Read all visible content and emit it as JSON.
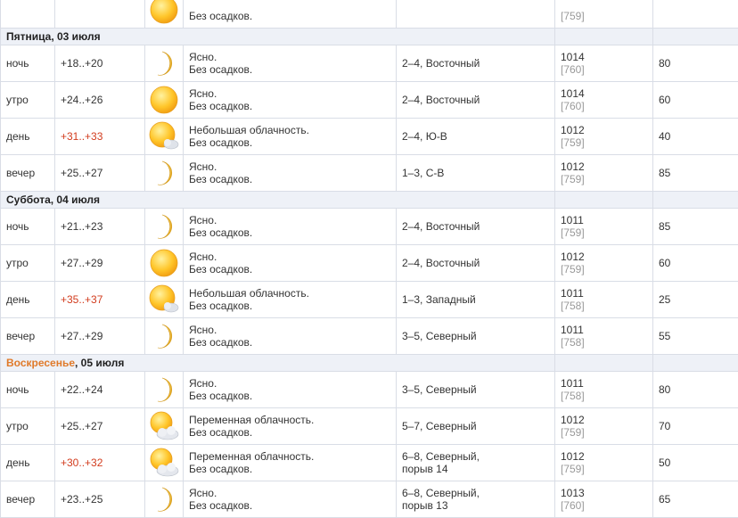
{
  "colors": {
    "hot_temp": "#d23c1e",
    "weekend": "#e07a2a",
    "grid": "#d9dde6",
    "day_header_bg": "#eef1f7"
  },
  "prev_row": {
    "icon": "sun-icon",
    "condition_tail": "Без осадков.",
    "pressure_mm": "[759]"
  },
  "days": [
    {
      "name": "Пятница",
      "date": ", 03 июля",
      "weekend": false,
      "rows": [
        {
          "period": "ночь",
          "temp": "+18..+20",
          "hot": false,
          "icon": "moon-icon",
          "cond1": "Ясно.",
          "cond2": "Без осадков.",
          "wind": "2–4, Восточный",
          "press_hpa": "1014",
          "press_mm": "[760]",
          "humidity": "80"
        },
        {
          "period": "утро",
          "temp": "+24..+26",
          "hot": false,
          "icon": "sun-icon",
          "cond1": "Ясно.",
          "cond2": "Без осадков.",
          "wind": "2–4, Восточный",
          "press_hpa": "1014",
          "press_mm": "[760]",
          "humidity": "60"
        },
        {
          "period": "день",
          "temp": "+31..+33",
          "hot": true,
          "icon": "sun-small-cloud-icon",
          "cond1": "Небольшая облачность.",
          "cond2": "Без осадков.",
          "wind": "2–4, Ю-В",
          "press_hpa": "1012",
          "press_mm": "[759]",
          "humidity": "40"
        },
        {
          "period": "вечер",
          "temp": "+25..+27",
          "hot": false,
          "icon": "moon-icon",
          "cond1": "Ясно.",
          "cond2": "Без осадков.",
          "wind": "1–3, С-В",
          "press_hpa": "1012",
          "press_mm": "[759]",
          "humidity": "85"
        }
      ]
    },
    {
      "name": "Суббота",
      "date": ", 04 июля",
      "weekend": false,
      "rows": [
        {
          "period": "ночь",
          "temp": "+21..+23",
          "hot": false,
          "icon": "moon-icon",
          "cond1": "Ясно.",
          "cond2": "Без осадков.",
          "wind": "2–4, Восточный",
          "press_hpa": "1011",
          "press_mm": "[759]",
          "humidity": "85"
        },
        {
          "period": "утро",
          "temp": "+27..+29",
          "hot": false,
          "icon": "sun-icon",
          "cond1": "Ясно.",
          "cond2": "Без осадков.",
          "wind": "2–4, Восточный",
          "press_hpa": "1012",
          "press_mm": "[759]",
          "humidity": "60"
        },
        {
          "period": "день",
          "temp": "+35..+37",
          "hot": true,
          "icon": "sun-small-cloud-icon",
          "cond1": "Небольшая облачность.",
          "cond2": "Без осадков.",
          "wind": "1–3, Западный",
          "press_hpa": "1011",
          "press_mm": "[758]",
          "humidity": "25"
        },
        {
          "period": "вечер",
          "temp": "+27..+29",
          "hot": false,
          "icon": "moon-icon",
          "cond1": "Ясно.",
          "cond2": "Без осадков.",
          "wind": "3–5, Северный",
          "press_hpa": "1011",
          "press_mm": "[758]",
          "humidity": "55"
        }
      ]
    },
    {
      "name": "Воскресенье",
      "date": ", 05 июля",
      "weekend": true,
      "rows": [
        {
          "period": "ночь",
          "temp": "+22..+24",
          "hot": false,
          "icon": "moon-icon",
          "cond1": "Ясно.",
          "cond2": "Без осадков.",
          "wind": "3–5, Северный",
          "press_hpa": "1011",
          "press_mm": "[758]",
          "humidity": "80"
        },
        {
          "period": "утро",
          "temp": "+25..+27",
          "hot": false,
          "icon": "sun-cloud-icon",
          "cond1": "Переменная облачность.",
          "cond2": "Без осадков.",
          "wind": "5–7, Северный",
          "press_hpa": "1012",
          "press_mm": "[759]",
          "humidity": "70"
        },
        {
          "period": "день",
          "temp": "+30..+32",
          "hot": true,
          "icon": "sun-cloud-icon",
          "cond1": "Переменная облачность.",
          "cond2": "Без осадков.",
          "wind": "6–8, Северный,",
          "wind2": "порыв 14",
          "press_hpa": "1012",
          "press_mm": "[759]",
          "humidity": "50"
        },
        {
          "period": "вечер",
          "temp": "+23..+25",
          "hot": false,
          "icon": "moon-icon",
          "cond1": "Ясно.",
          "cond2": "Без осадков.",
          "wind": "6–8, Северный,",
          "wind2": "порыв 13",
          "press_hpa": "1013",
          "press_mm": "[760]",
          "humidity": "65"
        }
      ]
    }
  ]
}
